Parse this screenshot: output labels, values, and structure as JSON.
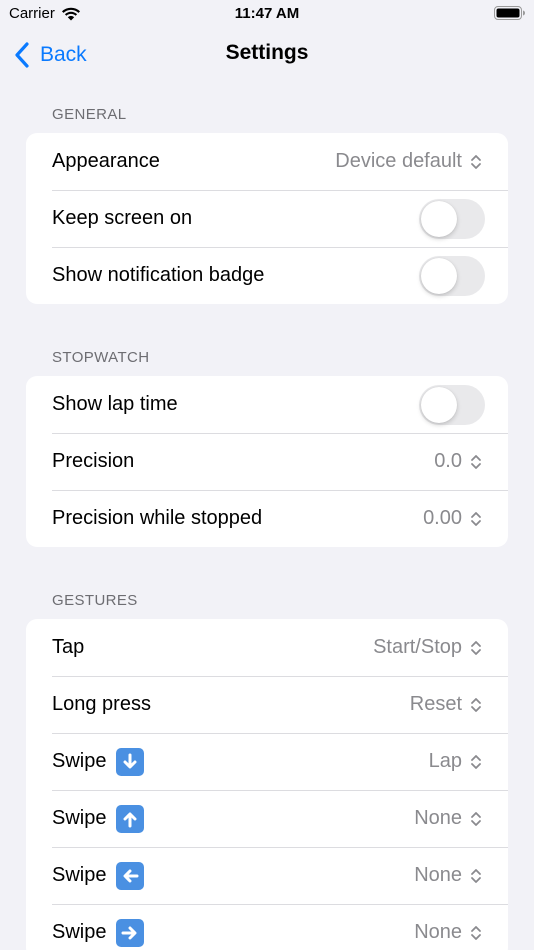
{
  "status_bar": {
    "carrier": "Carrier",
    "time": "11:47 AM"
  },
  "nav": {
    "back_label": "Back",
    "title": "Settings"
  },
  "sections": {
    "general": {
      "header": "GENERAL",
      "appearance": {
        "label": "Appearance",
        "value": "Device default"
      },
      "keep_screen_on": {
        "label": "Keep screen on",
        "on": false
      },
      "show_badge": {
        "label": "Show notification badge",
        "on": false
      }
    },
    "stopwatch": {
      "header": "STOPWATCH",
      "show_lap_time": {
        "label": "Show lap time",
        "on": false
      },
      "precision": {
        "label": "Precision",
        "value": "0.0"
      },
      "precision_stopped": {
        "label": "Precision while stopped",
        "value": "0.00"
      }
    },
    "gestures": {
      "header": "GESTURES",
      "tap": {
        "label": "Tap",
        "value": "Start/Stop"
      },
      "long_press": {
        "label": "Long press",
        "value": "Reset"
      },
      "swipe_down": {
        "label": "Swipe",
        "icon": "arrow-down-icon",
        "value": "Lap"
      },
      "swipe_up": {
        "label": "Swipe",
        "icon": "arrow-up-icon",
        "value": "None"
      },
      "swipe_left": {
        "label": "Swipe",
        "icon": "arrow-left-icon",
        "value": "None"
      },
      "swipe_right": {
        "label": "Swipe",
        "icon": "arrow-right-icon",
        "value": "None"
      }
    }
  },
  "colors": {
    "accent": "#0a7aff",
    "background": "#f2f2f7",
    "arrow_emoji": "#4a90e2"
  }
}
